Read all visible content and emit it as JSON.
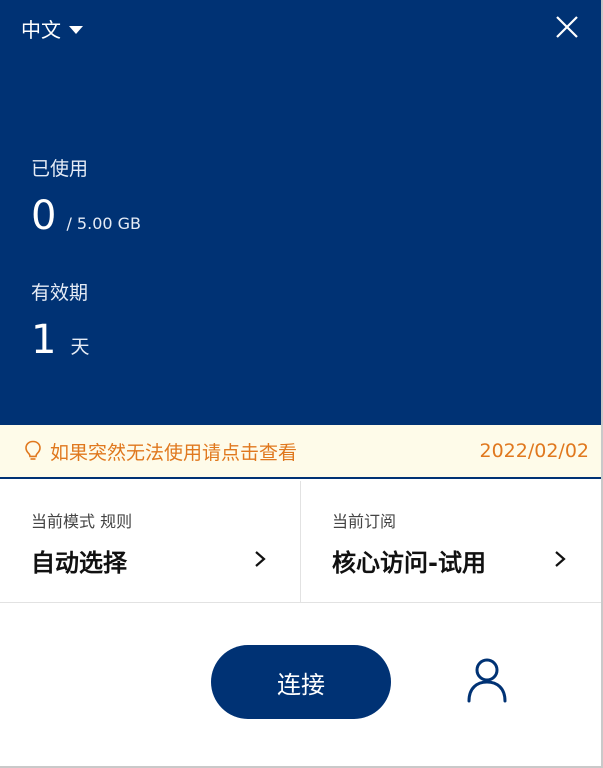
{
  "header": {
    "language": "中文",
    "close_icon": "close-icon"
  },
  "usage": {
    "used_label": "已使用",
    "used_value": "0",
    "used_total": "/ 5.00 GB",
    "validity_label": "有效期",
    "validity_value": "1",
    "validity_unit": "天"
  },
  "notice": {
    "icon": "lightbulb-icon",
    "text": "如果突然无法使用请点击查看",
    "date": "2022/02/02"
  },
  "mode_panel": {
    "title": "当前模式 规则",
    "value": "自动选择",
    "chevron_icon": "chevron-right-icon"
  },
  "subscription_panel": {
    "title": "当前订阅",
    "value": "核心访问-试用",
    "chevron_icon": "chevron-right-icon"
  },
  "footer": {
    "connect_label": "连接",
    "user_icon": "user-icon"
  },
  "colors": {
    "primary": "#003274",
    "notice_bg": "#fefbe9",
    "notice_text": "#e0781e"
  }
}
